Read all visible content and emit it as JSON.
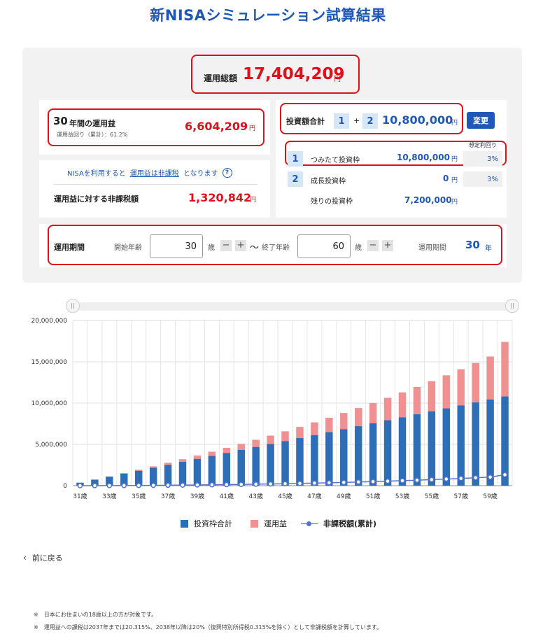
{
  "page": {
    "title": "新NISAシミュレーション試算結果"
  },
  "total": {
    "label": "運用総額",
    "value": "17,404,209",
    "unit": "円"
  },
  "profit": {
    "years": "30",
    "label": "年間の運用益",
    "sub": "運用益回り（累計）：61.2%",
    "value": "6,604,209",
    "unit": "円"
  },
  "nisa_info": {
    "prefix": "NISAを利用すると",
    "link": "運用益は非課税",
    "suffix": "となります",
    "help_icon": "?"
  },
  "tax_free": {
    "label": "運用益に対する非課税額",
    "value": "1,320,842",
    "unit": "円"
  },
  "investment": {
    "label": "投資額合計",
    "badge1": "1",
    "plus": "+",
    "badge2": "2",
    "value": "10,800,000",
    "unit": "円",
    "change_button": "変更",
    "rate_header": "想定利回り"
  },
  "frames": [
    {
      "badge": "1",
      "name": "つみたて投資枠",
      "value": "10,800,000",
      "unit": "円",
      "rate": "3%"
    },
    {
      "badge": "2",
      "name": "成長投資枠",
      "value": "0",
      "unit": "円",
      "rate": "3%"
    },
    {
      "badge": "",
      "name": "残りの投資枠",
      "value": "7,200,000",
      "unit": "円",
      "rate": ""
    }
  ],
  "period": {
    "label": "運用期間",
    "start_label": "開始年齢",
    "start_value": "30",
    "age_unit": "歳",
    "tilde": "〜",
    "end_label": "終了年齢",
    "end_value": "60",
    "period_label": "運用期間",
    "period_value": "30",
    "period_unit": "年",
    "minus": "−",
    "plus": "+"
  },
  "chart_data": {
    "type": "bar",
    "stacked": true,
    "ylim": [
      0,
      20000000
    ],
    "yticks": [
      "20,000,000",
      "15,000,000",
      "10,000,000",
      "5,000,000",
      "0"
    ],
    "categories": [
      "31歳",
      "32歳",
      "33歳",
      "34歳",
      "35歳",
      "36歳",
      "37歳",
      "38歳",
      "39歳",
      "40歳",
      "41歳",
      "42歳",
      "43歳",
      "44歳",
      "45歳",
      "46歳",
      "47歳",
      "48歳",
      "49歳",
      "50歳",
      "51歳",
      "52歳",
      "53歳",
      "54歳",
      "55歳",
      "56歳",
      "57歳",
      "58歳",
      "59歳",
      "60歳"
    ],
    "xtick_labels": [
      "31歳",
      "33歳",
      "35歳",
      "37歳",
      "39歳",
      "41歳",
      "43歳",
      "45歳",
      "47歳",
      "49歳",
      "51歳",
      "53歳",
      "55歳",
      "57歳",
      "59歳"
    ],
    "series": [
      {
        "name": "投資枠合計",
        "color": "#2e6db7",
        "values": [
          360000,
          720000,
          1080000,
          1440000,
          1800000,
          2160000,
          2520000,
          2880000,
          3240000,
          3600000,
          3960000,
          4320000,
          4680000,
          5040000,
          5400000,
          5760000,
          6120000,
          6480000,
          6840000,
          7200000,
          7560000,
          7920000,
          8280000,
          8640000,
          9000000,
          9360000,
          9720000,
          10080000,
          10440000,
          10800000
        ]
      },
      {
        "name": "運用益",
        "color": "#f09090",
        "values": [
          5000,
          20000,
          45000,
          80000,
          125000,
          180000,
          245000,
          320000,
          410000,
          510000,
          620000,
          740000,
          875000,
          1020000,
          1180000,
          1350000,
          1540000,
          1740000,
          1960000,
          2200000,
          2450000,
          2720000,
          3010000,
          3320000,
          3650000,
          4000000,
          4380000,
          4780000,
          5200000,
          6604209
        ]
      },
      {
        "name": "非課税額(累計)",
        "color": "#5575c8",
        "values": [
          1000,
          4000,
          9000,
          16000,
          25000,
          36000,
          49000,
          64000,
          82000,
          102000,
          124000,
          148000,
          175000,
          204000,
          236000,
          270000,
          308000,
          348000,
          392000,
          440000,
          490000,
          544000,
          602000,
          664000,
          730000,
          800000,
          876000,
          956000,
          1040000,
          1320842
        ]
      }
    ],
    "legend": [
      "投資枠合計",
      "運用益",
      "非課税額(累計)"
    ],
    "legend_placement": "bottom-center",
    "grid": true
  },
  "nav": {
    "back": "前に戻る"
  },
  "notes": [
    "※　日本にお住まいの18歳以上の方が対象です。",
    "※　運用益への課税は2037年までは20.315%、2038年以降は20%（復興特別所得税0.315%を除く）として非課税額を計算しています。"
  ],
  "colors": {
    "accent": "#1f58b6",
    "highlight": "#e0101a",
    "invest": "#2e6db7",
    "profit": "#f09090",
    "tax": "#5575c8"
  }
}
